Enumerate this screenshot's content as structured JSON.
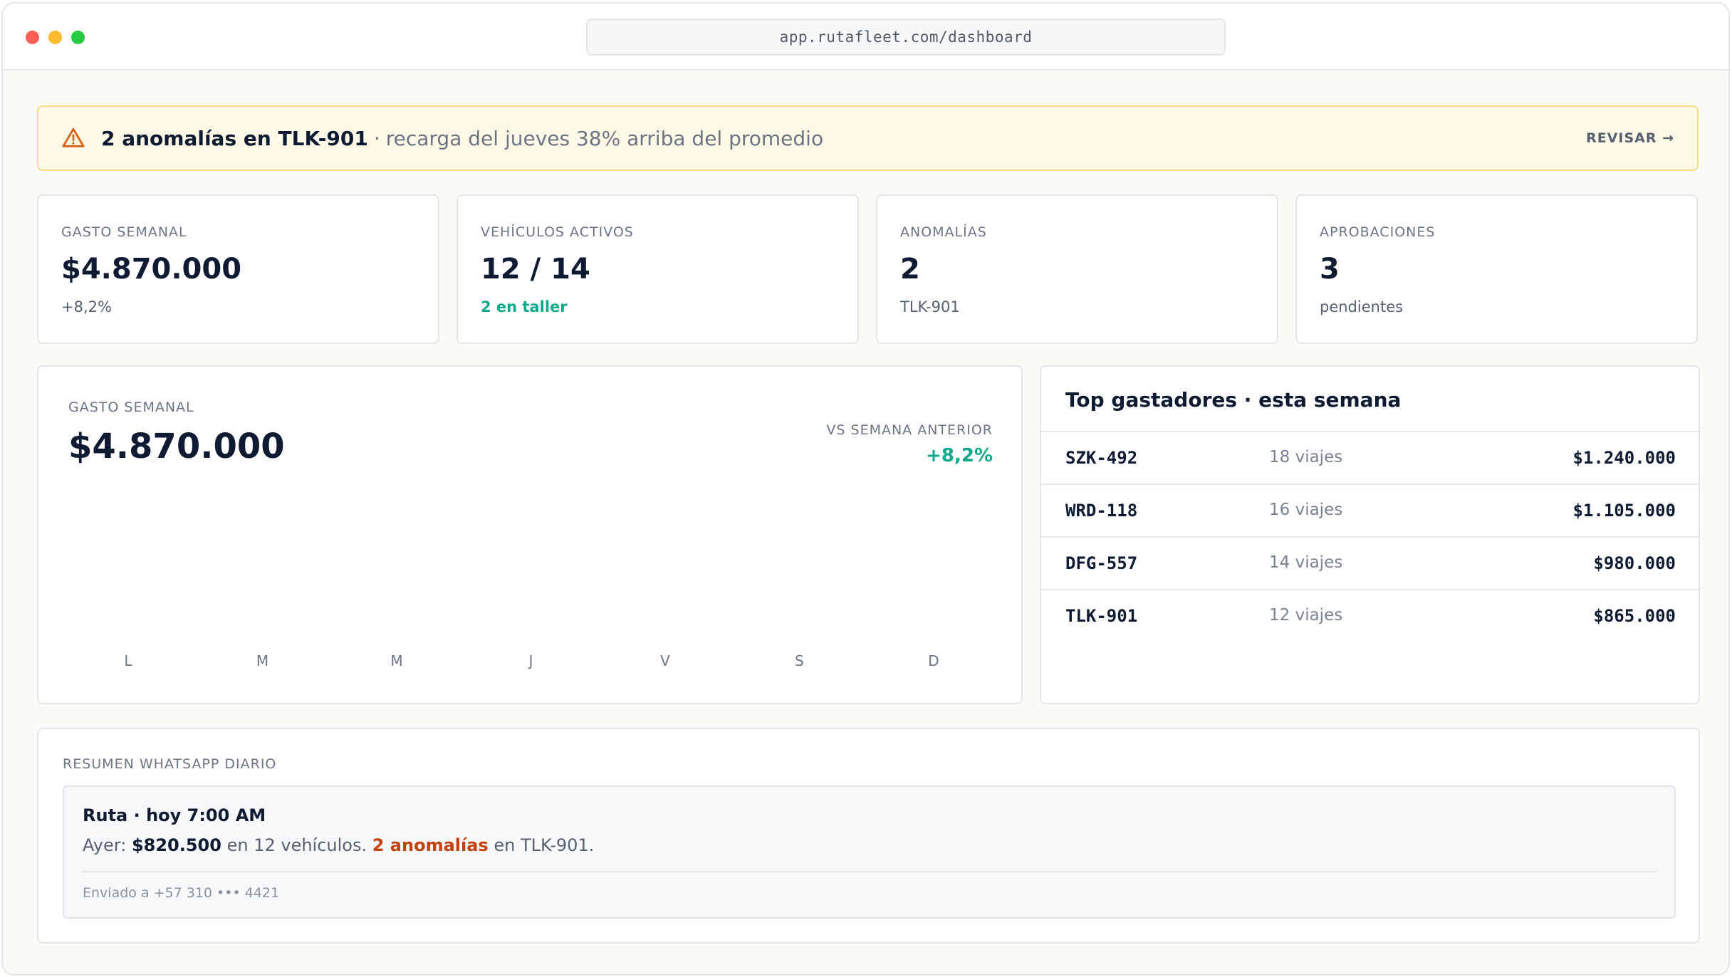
{
  "browser": {
    "url": "app.rutafleet.com/dashboard"
  },
  "alert": {
    "icon": "warning-triangle-icon",
    "title": "2 anomalías en TLK-901",
    "separator": "·",
    "description": "recarga del jueves 38% arriba del promedio",
    "action": "REVISAR →"
  },
  "stats": [
    {
      "label": "GASTO SEMANAL",
      "value": "$4.870.000",
      "sub": "+8,2%"
    },
    {
      "label": "VEHÍCULOS ACTIVOS",
      "value": "12 / 14",
      "sub": "2 en taller"
    },
    {
      "label": "ANOMALÍAS",
      "value": "2",
      "sub": "TLK-901"
    },
    {
      "label": "APROBACIONES",
      "value": "3",
      "sub": "pendientes"
    }
  ],
  "weekly_chart": {
    "label": "GASTO SEMANAL",
    "value": "$4.870.000",
    "compare_label": "VS SEMANA ANTERIOR",
    "compare_value": "+8,2%"
  },
  "chart_data": {
    "type": "bar",
    "categories": [
      "L",
      "M",
      "M",
      "J",
      "V",
      "S",
      "D"
    ],
    "values": [],
    "title": "",
    "xlabel": "",
    "ylabel": ""
  },
  "top_spenders": {
    "title": "Top gastadores · esta semana",
    "rows": [
      {
        "plate": "SZK-492",
        "trips": "18 viajes",
        "amount": "$1.240.000"
      },
      {
        "plate": "WRD-118",
        "trips": "16 viajes",
        "amount": "$1.105.000"
      },
      {
        "plate": "DFG-557",
        "trips": "14 viajes",
        "amount": "$980.000"
      },
      {
        "plate": "TLK-901",
        "trips": "12 viajes",
        "amount": "$865.000"
      }
    ]
  },
  "whatsapp": {
    "label": "RESUMEN WHATSAPP DIARIO",
    "title": "Ruta · hoy 7:00 AM",
    "msg_prefix": "Ayer:",
    "msg_amount": "$820.500",
    "msg_mid": "en 12 vehículos.",
    "msg_anomalies": "2 anomalías",
    "msg_suffix": "en TLK-901.",
    "sent": "Enviado a +57 310 ••• 4421"
  },
  "colors": {
    "accent_teal": "#0fa98b",
    "warning": "#c2410c",
    "alert_bg": "#fef9e6"
  }
}
